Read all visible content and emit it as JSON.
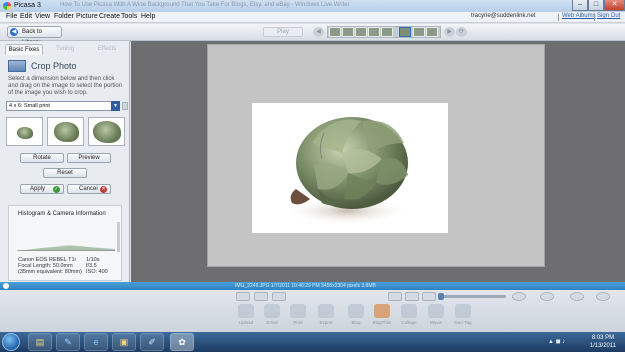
{
  "window": {
    "title": "Picasa 3",
    "ghost_title": "How To Use Picasa With A Wide Background That You Take For Blogs, Etsy, and eBay - Windows Live Writer",
    "min": "–",
    "max": "□",
    "close": "✕"
  },
  "menu": [
    "File",
    "Edit",
    "View",
    "Folder",
    "Picture",
    "Create",
    "Tools",
    "Help"
  ],
  "account": {
    "email": "tracyrie@suddenlink.net",
    "web_albums": "Web Albums",
    "sign_out": "Sign Out"
  },
  "toolbar": {
    "back_label": "Back to Library",
    "play_label": "Play"
  },
  "tabs": [
    {
      "label": "Basic Fixes"
    },
    {
      "label": "Tuning"
    },
    {
      "label": "Effects"
    }
  ],
  "crop": {
    "title": "Crop Photo",
    "instructions": "Select a dimension below and then click and drag on the image to select the portion of the image you wish to crop.",
    "size_selected": "4 x 6:  Small print"
  },
  "buttons": {
    "rotate": "Rotate",
    "preview": "Preview",
    "reset": "Reset",
    "apply": "Apply",
    "cancel": "Cancel"
  },
  "histogram": {
    "title": "Histogram & Camera Information",
    "camera": "Canon EOS REBEL T1i",
    "focal_label": "Focal Length: 50.0mm",
    "equiv_label": "(35mm equivalent:  80mm)",
    "shutter": "1/10s",
    "aperture": "f/3.5",
    "iso": "ISO: 400"
  },
  "status": {
    "text": "IMG_2246.JPG     1/7/2011 10:46:29 PM     3456x2304 pixels     3.8MB"
  },
  "tray_labels": [
    "Upload",
    "Email",
    "Print",
    "Export",
    "Blog",
    "BlogThis!",
    "Collage",
    "Movie",
    "Geo-Tag"
  ],
  "taskbar": {
    "time": "8:03 PM",
    "date": "1/13/2011"
  }
}
